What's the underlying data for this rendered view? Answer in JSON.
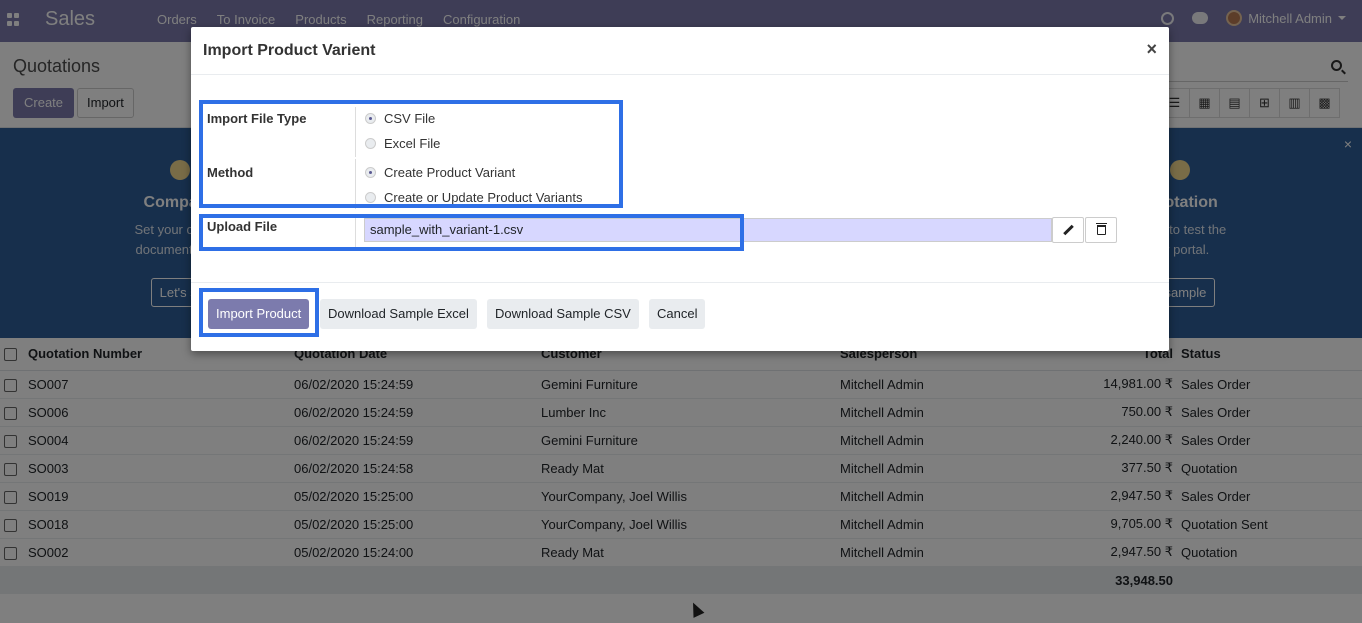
{
  "navbar": {
    "app_name": "Sales",
    "menu": [
      "Orders",
      "To Invoice",
      "Products",
      "Reporting",
      "Configuration"
    ],
    "user_name": "Mitchell Admin"
  },
  "control_panel": {
    "title": "Quotations",
    "create_label": "Create",
    "import_label": "Import"
  },
  "banner": {
    "close_label": "×",
    "step_left": {
      "title": "Company",
      "text_line1": "Set your compa",
      "text_line2": "documents hea",
      "button": "Let's st"
    },
    "step_right": {
      "title": "Quotation",
      "text_line1": "tation to test the",
      "text_line2": "ner portal.",
      "button": "d sample"
    }
  },
  "table": {
    "headers": [
      "Quotation Number",
      "Quotation Date",
      "Customer",
      "Salesperson",
      "Total",
      "Status"
    ],
    "rows": [
      {
        "number": "SO007",
        "date": "06/02/2020 15:24:59",
        "customer": "Gemini Furniture",
        "salesperson": "Mitchell Admin",
        "total": "14,981.00 ₹",
        "status": "Sales Order"
      },
      {
        "number": "SO006",
        "date": "06/02/2020 15:24:59",
        "customer": "Lumber Inc",
        "salesperson": "Mitchell Admin",
        "total": "750.00 ₹",
        "status": "Sales Order"
      },
      {
        "number": "SO004",
        "date": "06/02/2020 15:24:59",
        "customer": "Gemini Furniture",
        "salesperson": "Mitchell Admin",
        "total": "2,240.00 ₹",
        "status": "Sales Order"
      },
      {
        "number": "SO003",
        "date": "06/02/2020 15:24:58",
        "customer": "Ready Mat",
        "salesperson": "Mitchell Admin",
        "total": "377.50 ₹",
        "status": "Quotation"
      },
      {
        "number": "SO019",
        "date": "05/02/2020 15:25:00",
        "customer": "YourCompany, Joel Willis",
        "salesperson": "Mitchell Admin",
        "total": "2,947.50 ₹",
        "status": "Sales Order"
      },
      {
        "number": "SO018",
        "date": "05/02/2020 15:25:00",
        "customer": "YourCompany, Joel Willis",
        "salesperson": "Mitchell Admin",
        "total": "9,705.00 ₹",
        "status": "Quotation Sent"
      },
      {
        "number": "SO002",
        "date": "05/02/2020 15:24:00",
        "customer": "Ready Mat",
        "salesperson": "Mitchell Admin",
        "total": "2,947.50 ₹",
        "status": "Quotation"
      }
    ],
    "grand_total": "33,948.50"
  },
  "modal": {
    "title": "Import Product Varient",
    "close_label": "×",
    "import_file_type_label": "Import File Type",
    "file_type_options": [
      "CSV File",
      "Excel File"
    ],
    "file_type_selected": "CSV File",
    "method_label": "Method",
    "method_options": [
      "Create Product Variant",
      "Create or Update Product Variants"
    ],
    "method_selected": "Create Product Variant",
    "upload_file_label": "Upload File",
    "upload_file_value": "sample_with_variant-1.csv",
    "buttons": {
      "import": "Import Product",
      "download_excel": "Download Sample Excel",
      "download_csv": "Download Sample CSV",
      "cancel": "Cancel"
    }
  },
  "colors": {
    "brand": "#7c7bad",
    "highlight": "#2e6fe6",
    "banner": "#2f5f99"
  }
}
